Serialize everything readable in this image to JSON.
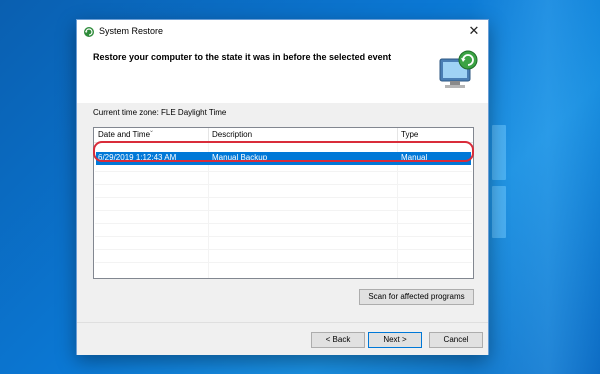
{
  "window": {
    "title": "System Restore",
    "close_glyph": "✕"
  },
  "header": {
    "heading": "Restore your computer to the state it was in before the selected event"
  },
  "main": {
    "timezone_label": "Current time zone: FLE Daylight Time",
    "columns": [
      "Date and Time",
      "Description",
      "Type"
    ],
    "rows": [
      {
        "date_time": "6/29/2019 1:12:43 AM",
        "description": "Manual Backup",
        "type": "Manual",
        "selected": true
      }
    ],
    "scan_button": "Scan for affected programs"
  },
  "footer": {
    "back_button": "< Back",
    "next_button": "Next >",
    "cancel_button": "Cancel"
  },
  "colors": {
    "selection": "#0078d7",
    "highlight_ring": "#d92c3a",
    "desktop": "#0b78d4"
  },
  "icons": {
    "app_icon": "system-restore-icon",
    "hero_icon": "computer-restore-icon"
  }
}
